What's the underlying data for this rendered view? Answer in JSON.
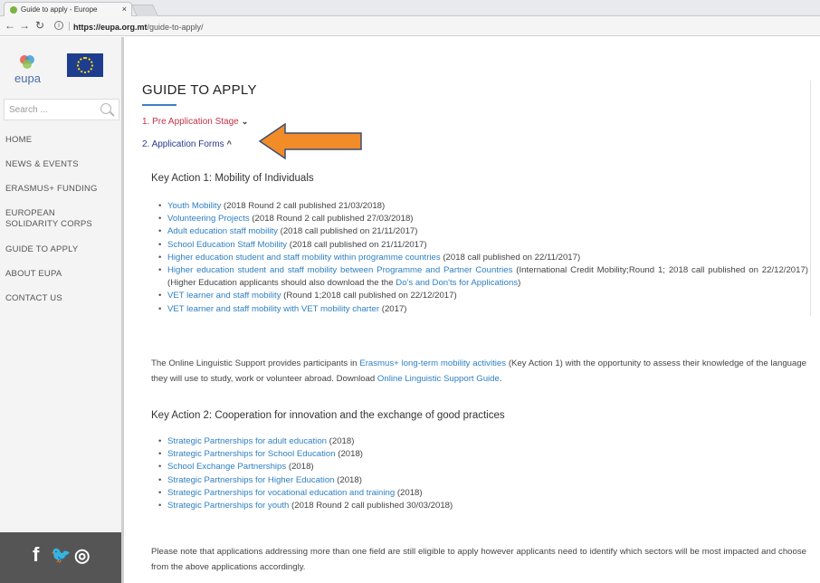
{
  "browser": {
    "tab_title": "Guide to apply - Europe",
    "close_glyph": "×",
    "url_host": "https://eupa.org.mt",
    "url_path": "/guide-to-apply/"
  },
  "sidebar": {
    "logo_text": "eupa",
    "search_placeholder": "Search ...",
    "menu": [
      "HOME",
      "NEWS & EVENTS",
      "ERASMUS+ FUNDING",
      "EUROPEAN SOLIDARITY CORPS",
      "GUIDE TO APPLY",
      "ABOUT EUPA",
      "CONTACT US"
    ],
    "social": [
      "f",
      "🐦",
      "◎"
    ]
  },
  "main": {
    "title": "GUIDE TO APPLY",
    "accordion": [
      {
        "label": "1. Pre Application Stage",
        "chevron": "⌄"
      },
      {
        "label": "2. Application Forms",
        "chevron": "^"
      }
    ],
    "ka1": {
      "heading": "Key Action 1: Mobility of Individuals",
      "items": [
        {
          "link": "Youth Mobility",
          "rest": " (2018 Round 2 call published 21/03/2018)"
        },
        {
          "link": "Volunteering Projects",
          "rest": " (2018 Round 2 call published 27/03/2018)"
        },
        {
          "link": "Adult education staff mobility",
          "rest": " (2018 call published on 21/11/2017)"
        },
        {
          "link": "School Education Staff Mobility",
          "rest": " (2018 call published on 21/11/2017)"
        },
        {
          "link": "Higher education student and staff mobility within programme countries",
          "rest": " (2018 call published on 22/11/2017)"
        },
        {
          "link": "Higher education student and staff mobility between Programme and Partner Countries",
          "rest": " (International Credit Mobility;Round 1; 2018 call published on 22/12/2017) (Higher Education applicants should also download the the ",
          "link2": "Do's and Don'ts for Applications",
          "rest2": ")"
        },
        {
          "link": "VET learner and staff mobility",
          "rest": " (Round 1;2018 call published on 22/12/2017)"
        },
        {
          "link": "VET learner and staff mobility with VET mobility charter",
          "rest": " (2017)"
        }
      ],
      "ols_text_1": "The Online Linguistic Support provides participants in ",
      "ols_link_1": "Erasmus+ long-term mobility activities",
      "ols_text_2": " (Key Action 1) with the opportunity to assess their knowledge of the language they will use to study, work or volunteer abroad. Download ",
      "ols_link_2": "Online Linguistic Support Guide",
      "ols_text_3": "."
    },
    "ka2": {
      "heading": "Key Action 2: Cooperation for innovation and the exchange of good practices",
      "items": [
        {
          "link": "Strategic Partnerships for adult education",
          "rest": " (2018)"
        },
        {
          "link": "Strategic Partnerships for School Education",
          "rest": " (2018)"
        },
        {
          "link": "School Exchange Partnerships",
          "rest": " (2018)"
        },
        {
          "link": "Strategic Partnerships for Higher Education",
          "rest": " (2018)"
        },
        {
          "link": "Strategic Partnerships for vocational education and training",
          "rest": " (2018)"
        },
        {
          "link": "Strategic Partnerships for youth",
          "rest": " (2018 Round 2 call published 30/03/2018)"
        }
      ],
      "note": "Please note that applications addressing more than one field are still eligible to apply however applicants need to identify which sectors will be most impacted and choose from the above applications accordingly."
    }
  },
  "colors": {
    "accent": "#3a7fc4",
    "link": "#2f80c2",
    "pre_stage": "#c0344a",
    "forms": "#2c3a8f",
    "arrow": "#f28c28"
  }
}
